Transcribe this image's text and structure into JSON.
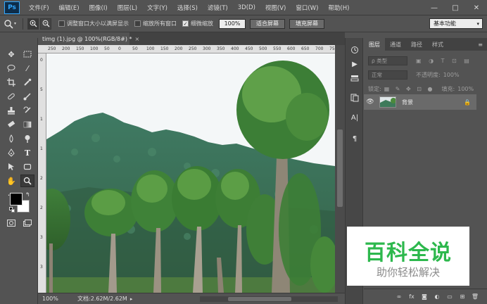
{
  "app": {
    "logo": "Ps",
    "menu": [
      "文件(F)",
      "编辑(E)",
      "图像(I)",
      "图层(L)",
      "文字(Y)",
      "选择(S)",
      "滤镜(T)",
      "3D(D)",
      "视图(V)",
      "窗口(W)",
      "帮助(H)"
    ],
    "window_controls": [
      "—",
      "□",
      "✕"
    ]
  },
  "options": {
    "resize_windows_label": "调整窗口大小以满屏显示",
    "resize_windows_checked": false,
    "zoom_all_label": "缩放所有窗口",
    "zoom_all_checked": false,
    "scrubby_zoom_label": "细微缩放",
    "scrubby_zoom_checked": true,
    "zoom_value": "100%",
    "fit_screen_label": "适合屏幕",
    "fill_screen_label": "填充屏幕",
    "workspace": "基本功能"
  },
  "document": {
    "tab_title": "timg (1).jpg @ 100%(RGB/8#) *",
    "tab_close": "×",
    "ruler_top": [
      "250",
      "200",
      "150",
      "100",
      "50",
      "0",
      "50",
      "100",
      "150",
      "200",
      "250",
      "300",
      "350",
      "400",
      "450",
      "500",
      "550",
      "600",
      "650",
      "700",
      "750"
    ],
    "ruler_left": [
      "0",
      "5",
      "1",
      "1",
      "2",
      "2",
      "3",
      "3"
    ],
    "status_zoom": "100%",
    "status_doc": "文档:2.62M/2.62M"
  },
  "layers_panel": {
    "tabs": [
      "图层",
      "通道",
      "路径",
      "样式"
    ],
    "active_tab": 0,
    "filter_label": "ρ 类型",
    "blend_mode": "正常",
    "opacity_label": "不透明度:",
    "opacity_value": "100%",
    "lock_label": "锁定:",
    "fill_label": "填充:",
    "fill_value": "100%",
    "layer_name": "背景",
    "footer_icons": [
      "link-icon",
      "fx-icon",
      "mask-icon",
      "adjustment-icon",
      "group-icon",
      "new-layer-icon",
      "trash-icon"
    ]
  },
  "watermark": {
    "title": "百科全说",
    "subtitle": "助你轻松解决"
  },
  "colors": {
    "ui_bg": "#535353",
    "panel_dark": "#424242",
    "watermark_green": "#2db84d"
  }
}
